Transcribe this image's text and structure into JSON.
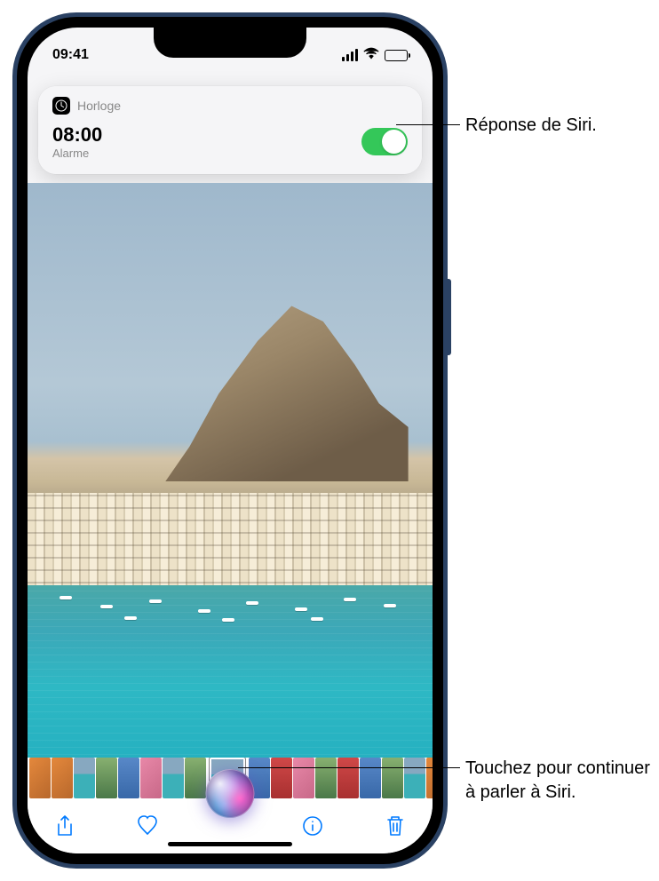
{
  "status_bar": {
    "time": "09:41"
  },
  "siri_card": {
    "app_name": "Horloge",
    "alarm_time": "08:00",
    "alarm_label": "Alarme",
    "toggle_on": true
  },
  "toolbar": {
    "share_name": "share",
    "favorite_name": "favorite",
    "info_name": "info",
    "delete_name": "delete"
  },
  "callouts": {
    "siri_response": "Réponse de Siri.",
    "siri_tap": "Touchez pour continuer à parler à Siri."
  }
}
